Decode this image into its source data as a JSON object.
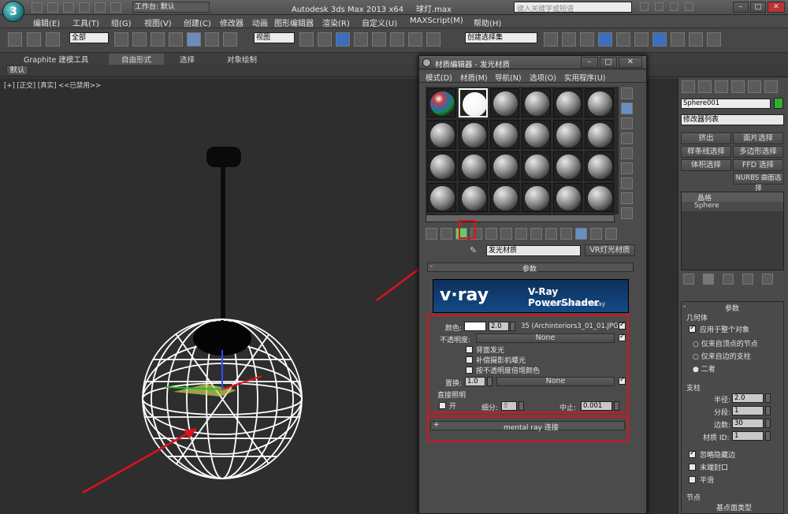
{
  "title": {
    "app": "Autodesk 3ds Max  2013 x64",
    "file": "球灯.max",
    "workspace": "工作台: 默认",
    "search_placeholder": "键入关键字或短语"
  },
  "menu": [
    "编辑(E)",
    "工具(T)",
    "组(G)",
    "视图(V)",
    "创建(C)",
    "修改器",
    "动画",
    "图形编辑器",
    "渲染(R)",
    "自定义(U)",
    "MAXScript(M)",
    "帮助(H)"
  ],
  "toolbar": {
    "filter": "全部",
    "refcoord": "视图",
    "named_sel": "创建选择集"
  },
  "ribbon": {
    "tabs": [
      "Graphite 建模工具",
      "自由形式",
      "选择",
      "对象绘制"
    ],
    "default_label": "默认"
  },
  "viewport": {
    "label_plus": "[+]",
    "label_view": "[正交]",
    "label_shade": "[真实]",
    "label_disabled": "<<已禁用>>"
  },
  "material_editor": {
    "title": "材质编辑器 - 发光材质",
    "menu": [
      "模式(D)",
      "材质(M)",
      "导航(N)",
      "选项(O)",
      "实用程序(U)"
    ],
    "material_name": "发光材质",
    "material_type": "VR灯光材质",
    "rollout_params": "参数",
    "banner_logo": "v·ray",
    "banner_title": "V-Ray PowerShader",
    "banner_sub": "optimized for V-Ray",
    "color_label": "颜色:",
    "color_value": "2.0",
    "color_map": "35 (Archinteriors3_01_01.JPG)",
    "opacity_label": "不透明度:",
    "opacity_map": "None",
    "backside": "背面发光",
    "compensate": "补偿摄影机曝光",
    "multiply": "按不透明度倍增颜色",
    "displace_label": "置换:",
    "displace_value": "1.0",
    "displace_map": "None",
    "direct_label": "直接照明",
    "on_label": "开",
    "subdiv_label": "细分:",
    "subdiv_value": "8",
    "cutoff_label": "中止:",
    "cutoff_value": "0.001",
    "mental_ray": "mental ray 连接",
    "plus": "+",
    "minus": "-"
  },
  "command_panel": {
    "object_name": "Sphere001",
    "modifier_list": "修改器列表",
    "buttons": [
      "挤出",
      "面片选择",
      "样条线选择",
      "多边形选择",
      "体积选择",
      "FFD 选择",
      "NURBS 曲面选择"
    ],
    "stack": [
      "晶格",
      "Sphere"
    ],
    "params_title": "参数",
    "geometry_title": "几何体",
    "apply_all": "应用于整个对象",
    "radio": [
      "仅来自顶点的节点",
      "仅来自边的支柱",
      "二者"
    ],
    "struts_title": "支柱",
    "radius_label": "半径:",
    "radius_value": "2.0",
    "segments_label": "分段:",
    "segments_value": "1",
    "sides_label": "边数:",
    "sides_value": "30",
    "matid_label": "材质 ID:",
    "matid_value": "1",
    "opt_hidden": "忽略隐藏边",
    "opt_cap": "末端封口",
    "opt_smooth": "平滑",
    "nodes_title": "节点",
    "base_type": "基点面类型"
  }
}
